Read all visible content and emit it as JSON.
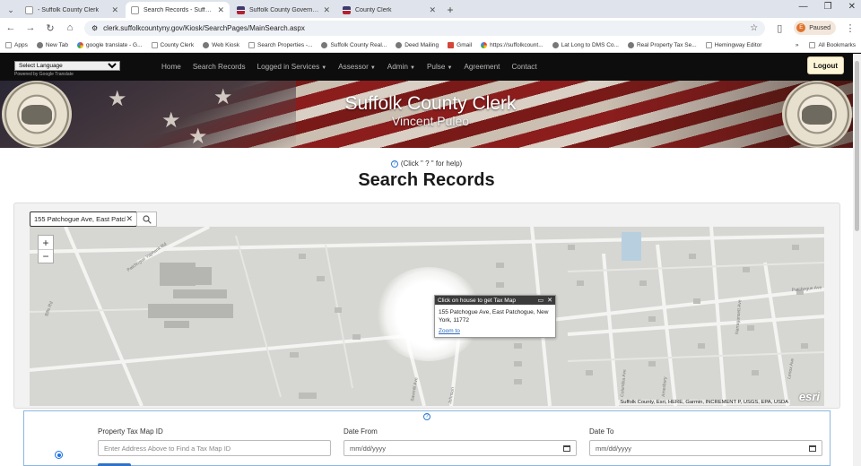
{
  "browser": {
    "tabs": [
      {
        "title": "- Suffolk County Clerk",
        "icon": "doc-icon",
        "active": false
      },
      {
        "title": "Search Records - Suffolk County",
        "icon": "doc-icon",
        "active": true
      },
      {
        "title": "Suffolk County Government > ...",
        "icon": "us-flag-icon",
        "active": false
      },
      {
        "title": "County Clerk",
        "icon": "us-flag-icon",
        "active": false
      }
    ],
    "url": "clerk.suffolkcountyny.gov/Kiosk/SearchPages/MainSearch.aspx",
    "profile_label": "Paused",
    "profile_initial": "E",
    "bookmarks": [
      "Apps",
      "New Tab",
      "google translate - G...",
      "County Clerk",
      "Web Kiosk",
      "Search Properties -...",
      "Suffolk County Real...",
      "Deed Mailing",
      "Gmail",
      "https://suffolkcount...",
      "Lat Long to DMS Co...",
      "Real Property Tax Se...",
      "Hemingway Editor"
    ],
    "all_bookmarks": "All Bookmarks"
  },
  "site": {
    "language_select": "Select Language",
    "powered_by": "Powered by Google Translate",
    "nav": {
      "home": "Home",
      "search_records": "Search Records",
      "logged_in_services": "Logged in Services",
      "assessor": "Assessor",
      "admin": "Admin",
      "pulse": "Pulse",
      "agreement": "Agreement",
      "contact": "Contact"
    },
    "logout": "Logout",
    "banner_title": "Suffolk County Clerk",
    "banner_subtitle": "Vincent Puleo"
  },
  "main": {
    "help_text": "(Click \" ? \" for help)",
    "page_title": "Search Records",
    "search_value": "155 Patchogue Ave, East Patch",
    "map": {
      "popup_title": "Click on house to get Tax Map",
      "popup_address": "155 Patchogue Ave, East Patchogue, New York, 11772",
      "popup_zoom": "Zoom to",
      "attribution": "Suffolk County, Esri, HERE, Garmin, INCREMENT P, USGS, EPA, USDA",
      "esri": "esri",
      "street_labels": [
        "Patchogue Yaphank Rd",
        "Bills Rd",
        "Patchogue Ave",
        "Columbia Ave",
        "Amesbury",
        "Narragansett Ave",
        "Lenox Ave",
        "Sawmill Ave",
        "Johnson"
      ]
    },
    "form": {
      "tax_map_label": "Property Tax Map ID",
      "tax_map_placeholder": "Enter Address Above to Find a Tax Map ID",
      "date_from_label": "Date From",
      "date_from_value": "mm/dd/yyyy",
      "date_to_label": "Date To",
      "date_to_value": "mm/dd/yyyy"
    }
  }
}
